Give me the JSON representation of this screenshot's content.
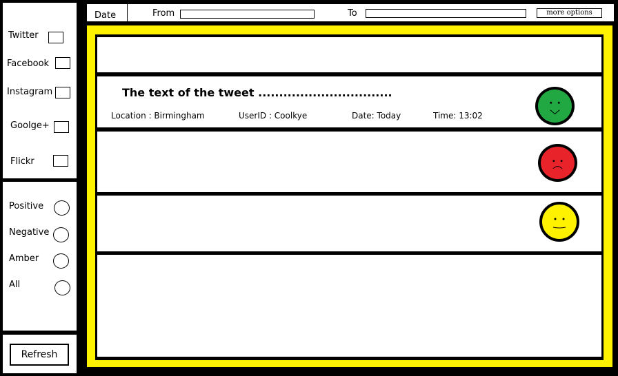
{
  "sources": {
    "items": [
      {
        "label": "Twitter"
      },
      {
        "label": "Facebook"
      },
      {
        "label": "Instagram"
      },
      {
        "label": "Goolge+"
      },
      {
        "label": "Flickr"
      }
    ]
  },
  "sentiment_filter": {
    "items": [
      {
        "label": "Positive"
      },
      {
        "label": "Negative"
      },
      {
        "label": "Amber"
      },
      {
        "label": "All"
      }
    ]
  },
  "refresh_label": "Refresh",
  "topbar": {
    "date_label": "Date",
    "from_label": "From",
    "from_value": "",
    "to_label": "To",
    "to_value": "",
    "more_options_label": "more options"
  },
  "tweet": {
    "text": "The text of the tweet",
    "ellipsis": "................................",
    "location": "Location : Birmingham",
    "user": "UserID : Coolkye",
    "date": "Date: Today",
    "time": "Time: 13:02"
  },
  "colors": {
    "positive": "#22a843",
    "negative": "#e8232a",
    "amber": "#fff200",
    "frame": "#fff200"
  }
}
